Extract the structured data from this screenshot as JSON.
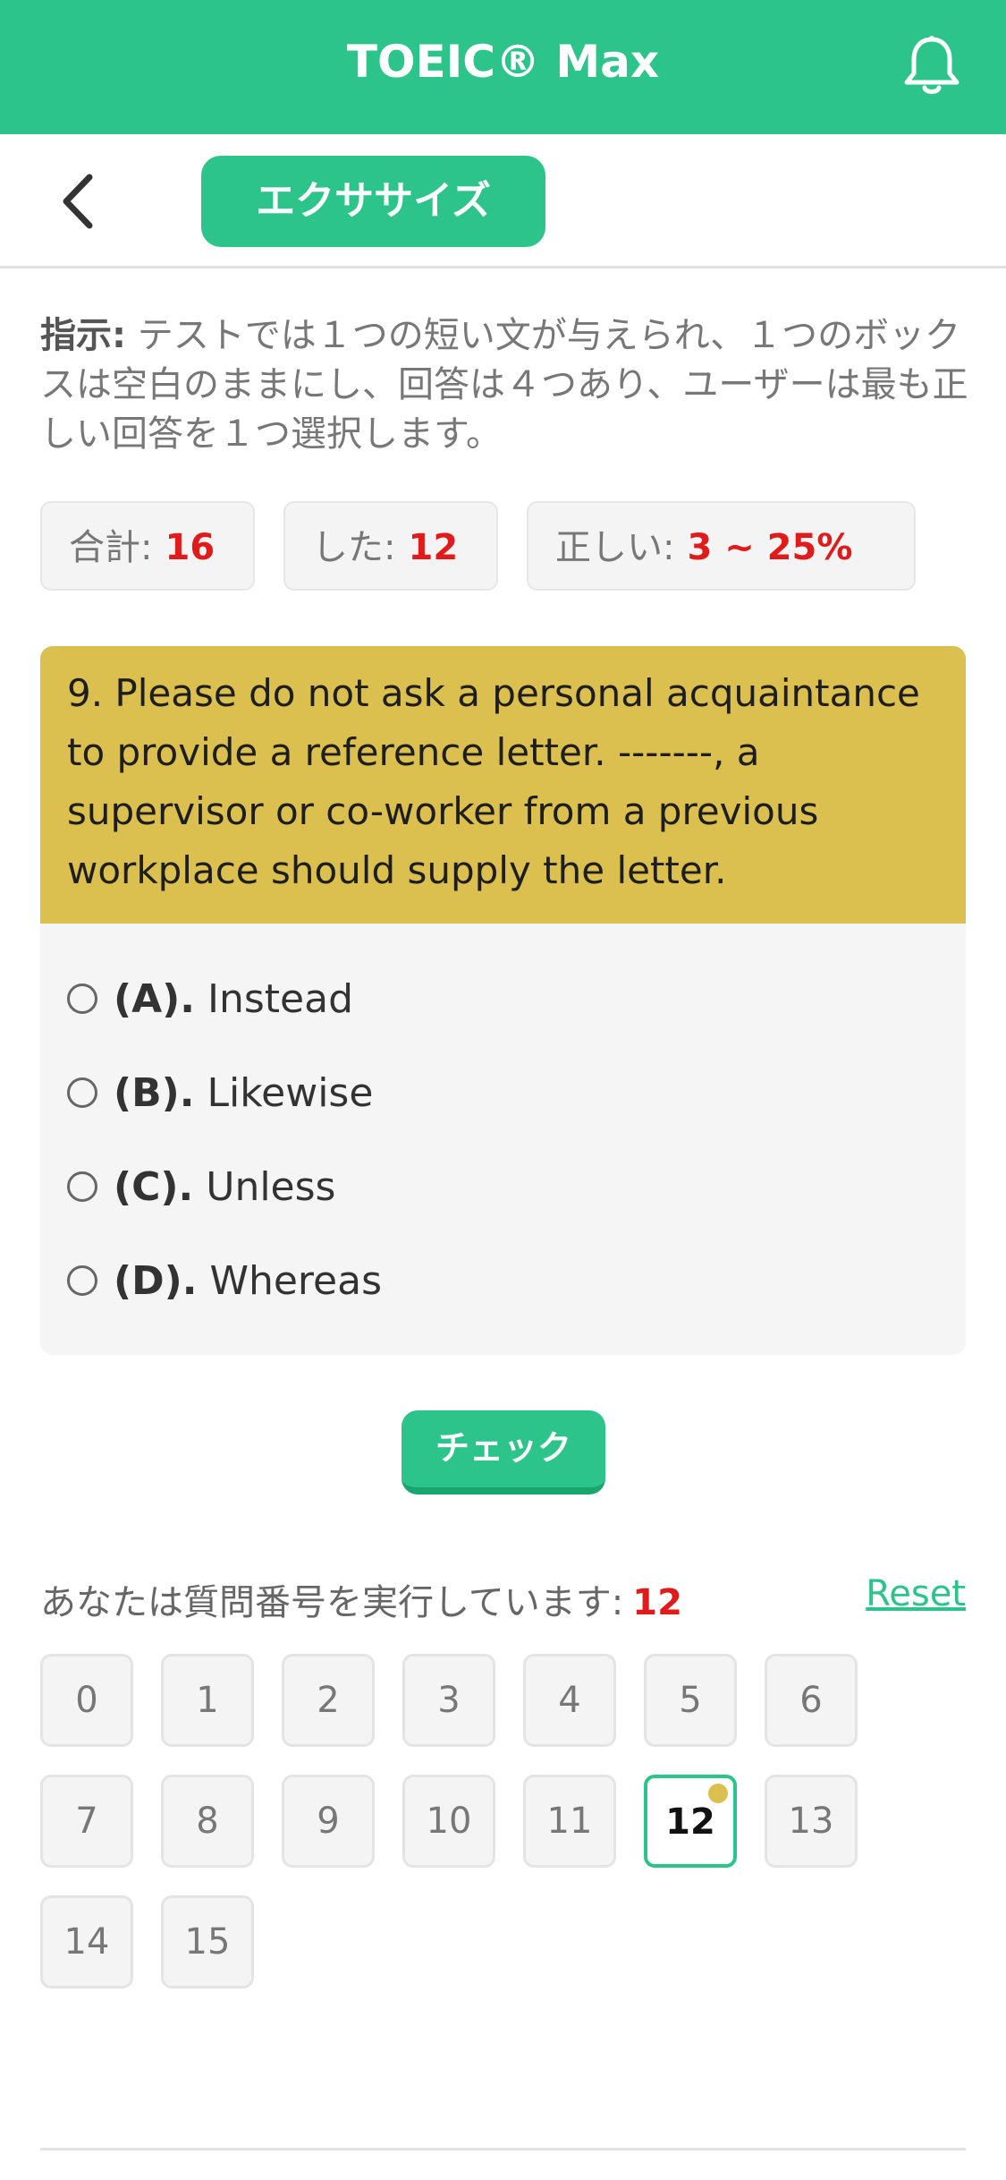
{
  "appbar": {
    "title": "TOEIC® Max",
    "bell_icon": "bell-icon"
  },
  "nav": {
    "back_icon": "chevron-left-icon",
    "tab_label": "エクササイズ"
  },
  "instructions": {
    "label": "指示:",
    "text": " テストでは１つの短い文が与えられ、１つのボックスは空白のままにし、回答は４つあり、ユーザーは最も正しい回答を１つ選択します。"
  },
  "stats": {
    "total_label": "合計:",
    "total_value": "16",
    "done_label": "した:",
    "done_value": "12",
    "correct_label": "正しい:",
    "correct_value": "3 ~ 25%"
  },
  "question": {
    "text": "9. Please do not ask a personal acquaintance to provide a reference letter. -------, a supervisor or co-worker from a previous workplace should supply the letter.",
    "options": [
      {
        "key": "(A).",
        "text": "Instead"
      },
      {
        "key": "(B).",
        "text": "Likewise"
      },
      {
        "key": "(C).",
        "text": "Unless"
      },
      {
        "key": "(D).",
        "text": "Whereas"
      }
    ]
  },
  "check_label": "チェック",
  "progress": {
    "running_label": "あなたは質問番号を実行しています:",
    "current": "12",
    "reset_label": "Reset",
    "numbers": [
      "0",
      "1",
      "2",
      "3",
      "4",
      "5",
      "6",
      "7",
      "8",
      "9",
      "10",
      "11",
      "12",
      "13",
      "14",
      "15"
    ]
  },
  "colors": {
    "accent": "#2dc48b",
    "question_bg": "#dbbf4f",
    "highlight": "#e11b1b"
  }
}
